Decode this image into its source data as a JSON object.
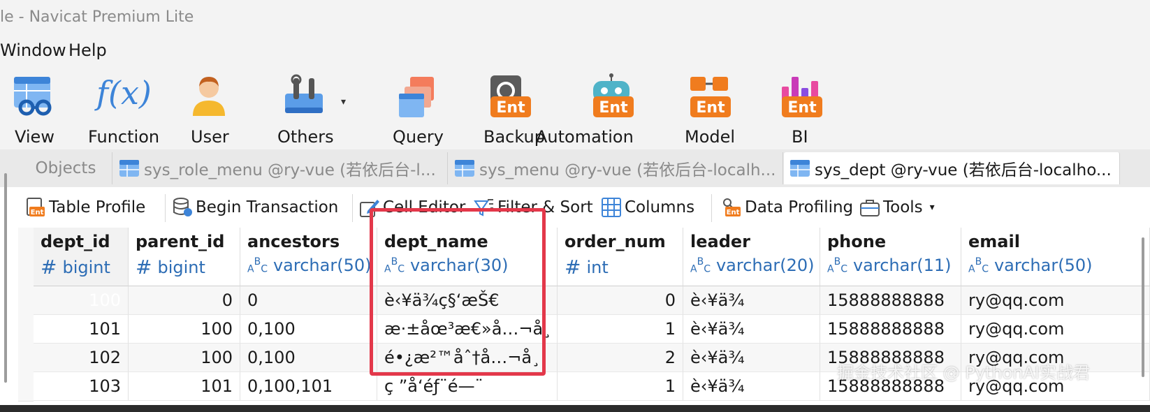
{
  "window": {
    "title": "le - Navicat Premium Lite"
  },
  "menu": {
    "items": [
      "Window",
      "Help"
    ]
  },
  "toolbar": {
    "items": [
      {
        "label": "View",
        "icon": "view-icon"
      },
      {
        "label": "Function",
        "icon": "function-icon"
      },
      {
        "label": "User",
        "icon": "user-icon"
      },
      {
        "label": "Others",
        "icon": "others-icon"
      },
      {
        "label": "Query",
        "icon": "query-icon"
      },
      {
        "label": "Backup",
        "icon": "backup-icon",
        "badge": "Ent"
      },
      {
        "label": "Automation",
        "icon": "automation-icon",
        "badge": "Ent"
      },
      {
        "label": "Model",
        "icon": "model-icon",
        "badge": "Ent"
      },
      {
        "label": "BI",
        "icon": "bi-icon",
        "badge": "Ent"
      }
    ],
    "function_glyph": "f(x)",
    "others_caret": "▾"
  },
  "tabs": {
    "objects": "Objects",
    "items": [
      {
        "label": "sys_role_menu @ry-vue (若依后台-l...",
        "active": false
      },
      {
        "label": "sys_menu @ry-vue (若依后台-localh...",
        "active": false
      },
      {
        "label": "sys_dept @ry-vue (若依后台-localho...",
        "active": true
      }
    ]
  },
  "subtoolbar": {
    "items": [
      {
        "label": "Table Profile",
        "icon": "table-profile-icon",
        "badge": "Ent"
      },
      {
        "label": "Begin Transaction",
        "icon": "database-icon"
      },
      {
        "label": "Cell Editor",
        "icon": "cell-editor-icon"
      },
      {
        "label": "Filter & Sort",
        "icon": "filter-sort-icon"
      },
      {
        "label": "Columns",
        "icon": "columns-icon"
      },
      {
        "label": "Data Profiling",
        "icon": "data-profiling-icon",
        "badge": "Ent"
      },
      {
        "label": "Tools",
        "icon": "tools-icon"
      }
    ],
    "tools_caret": "▾"
  },
  "grid": {
    "columns": [
      {
        "name": "dept_id",
        "type": "bigint",
        "type_kind": "#"
      },
      {
        "name": "parent_id",
        "type": "bigint",
        "type_kind": "#"
      },
      {
        "name": "ancestors",
        "type": "varchar(50)",
        "type_kind": "abc"
      },
      {
        "name": "dept_name",
        "type": "varchar(30)",
        "type_kind": "abc"
      },
      {
        "name": "order_num",
        "type": "int",
        "type_kind": "#"
      },
      {
        "name": "leader",
        "type": "varchar(20)",
        "type_kind": "abc"
      },
      {
        "name": "phone",
        "type": "varchar(11)",
        "type_kind": "abc"
      },
      {
        "name": "email",
        "type": "varchar(50)",
        "type_kind": "abc"
      }
    ],
    "hash_glyph": "#",
    "abc_glyph_a": "A",
    "abc_glyph_b": "B",
    "abc_glyph_c": "C",
    "rows": [
      [
        "100",
        "0",
        "0",
        "è‹¥ä¾ç§‘æŠ€",
        "0",
        "è‹¥ä¾",
        "15888888888",
        "ry@qq.com"
      ],
      [
        "101",
        "100",
        "0,100",
        "æ·±åœ³æ€»å…¬å¸",
        "1",
        "è‹¥ä¾",
        "15888888888",
        "ry@qq.com"
      ],
      [
        "102",
        "100",
        "0,100",
        "é•¿æ²™åˆ†å…¬å¸",
        "2",
        "è‹¥ä¾",
        "15888888888",
        "ry@qq.com"
      ],
      [
        "103",
        "101",
        "0,100,101",
        "ç ”å‘éƒ¨é—¨",
        "1",
        "è‹¥ä¾",
        "15888888888",
        "ry@qq.com"
      ]
    ]
  },
  "watermark": "掘金技术社区 @ PythonAI实战君",
  "colors": {
    "accent": "#3a7ad9",
    "highlight": "#e3384a",
    "type": "#2d6db5",
    "ent_badge": "#f07c1e"
  }
}
